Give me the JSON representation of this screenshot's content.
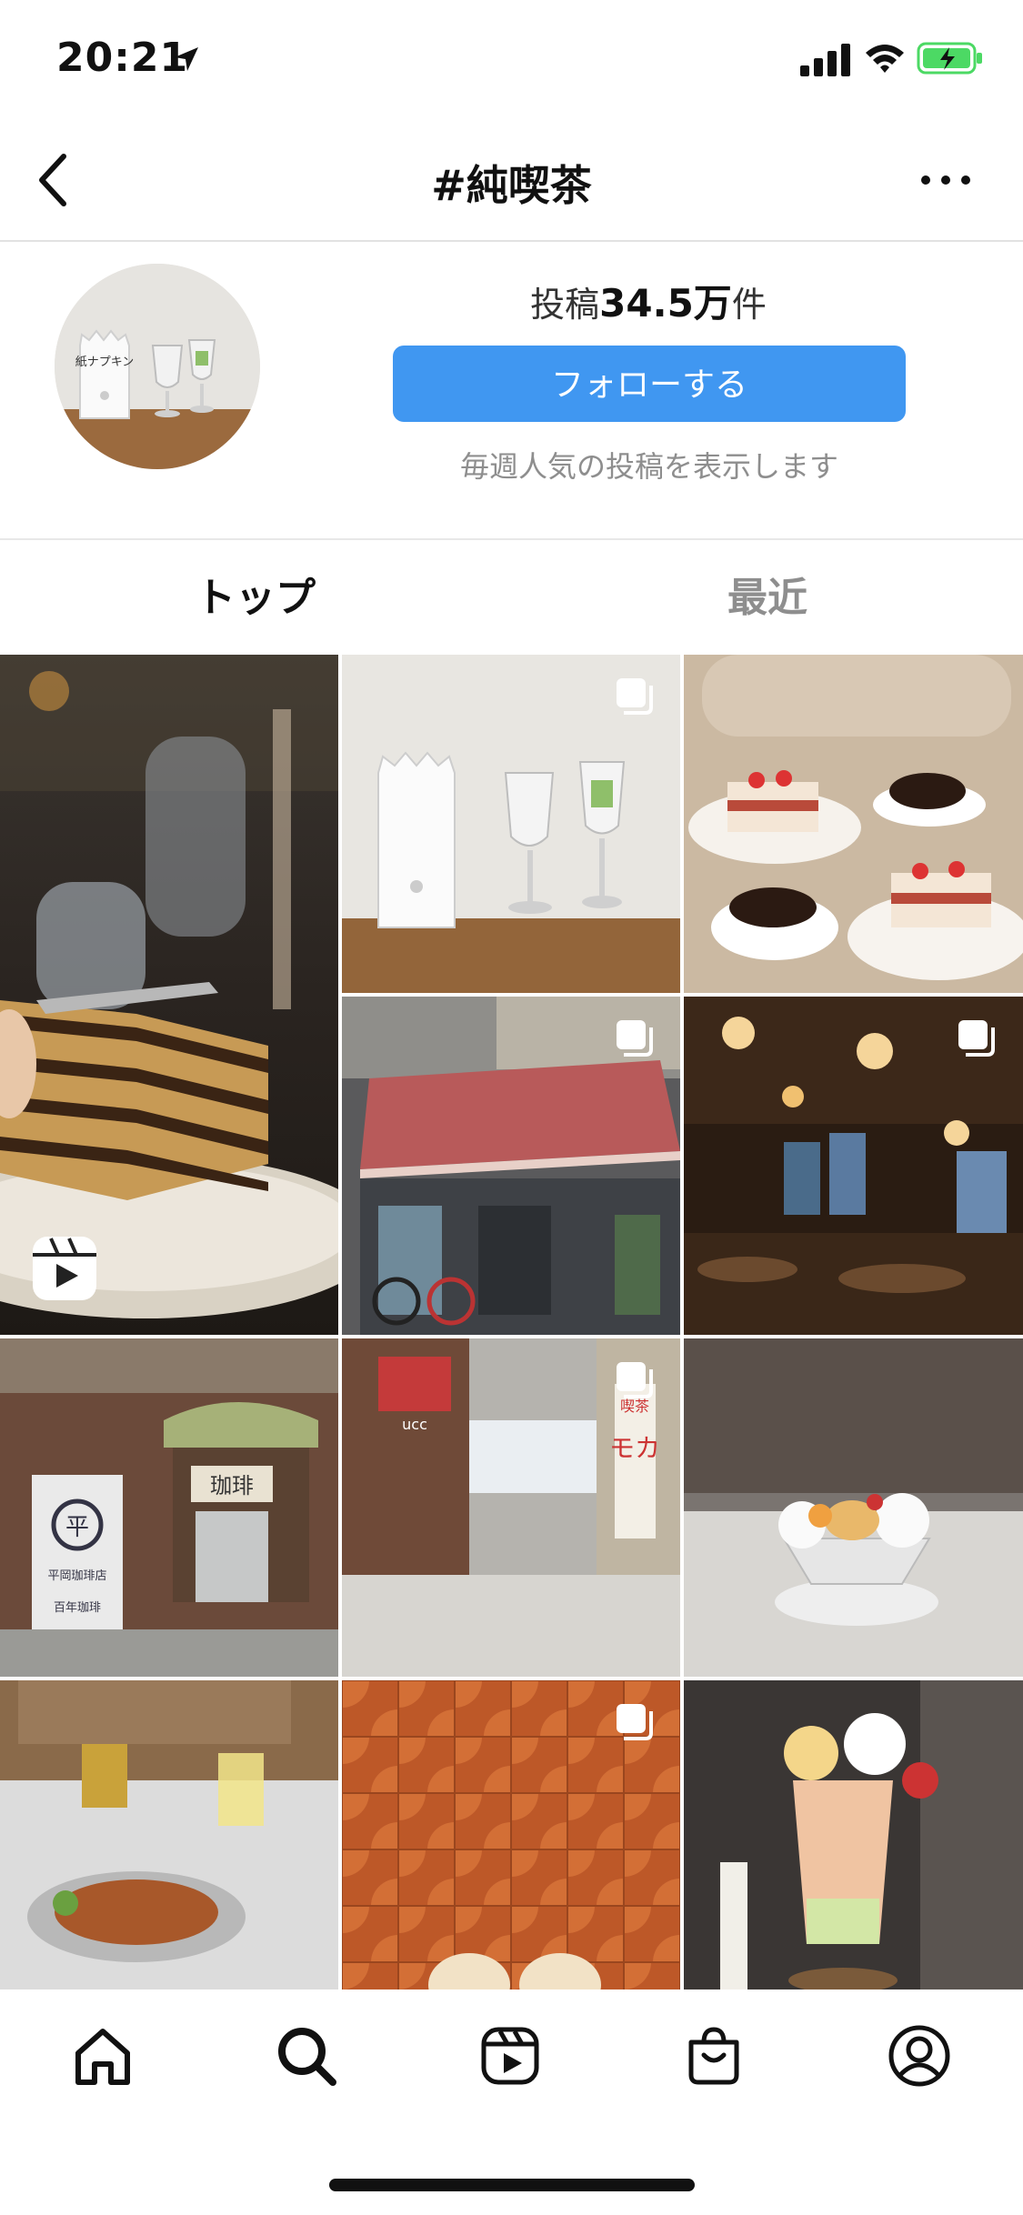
{
  "status_bar": {
    "time": "20:21"
  },
  "header": {
    "title": "#純喫茶",
    "back_icon": "chevron-left-icon",
    "more_icon": "ellipsis-icon"
  },
  "profile": {
    "posts_label": "投稿",
    "posts_count": "34.5万",
    "posts_unit": "件",
    "follow_label": "フォローする",
    "hint": "毎週人気の投稿を表示します",
    "avatar_caption": "紙ナプキン"
  },
  "tabs": [
    {
      "label": "トップ",
      "active": true
    },
    {
      "label": "最近",
      "active": false
    }
  ],
  "grid": [
    {
      "desc": "layered chocolate cake",
      "badge": "reels-icon"
    },
    {
      "desc": "napkin holder and glasses",
      "badge": "multi-photo-icon"
    },
    {
      "desc": "strawberry cakes and coffee",
      "badge": ""
    },
    {
      "desc": "cafe storefront with awning",
      "badge": "multi-photo-icon"
    },
    {
      "desc": "dark cafe interior",
      "badge": "multi-photo-icon"
    },
    {
      "desc": "old coffee shop facade",
      "badge": ""
    },
    {
      "desc": "moka cafe sign on street",
      "badge": "multi-photo-icon"
    },
    {
      "desc": "pudding parfait",
      "badge": ""
    },
    {
      "desc": "spaghetti and lemon soda",
      "badge": ""
    },
    {
      "desc": "orange tiled floor",
      "badge": "multi-photo-icon"
    },
    {
      "desc": "fruit parfait in glass",
      "badge": ""
    }
  ],
  "signs": {
    "sign1": "珈琲",
    "sign2": "喫茶",
    "sign3": "モカ",
    "sign4": "ucc",
    "sign5": "平",
    "sign6": "平岡珈琲店",
    "sign7": "百年珈琲"
  },
  "tabbar": [
    "home-icon",
    "search-icon",
    "reels-icon",
    "shop-icon",
    "profile-icon"
  ],
  "colors": {
    "accent": "#4097f1",
    "muted": "#8e8e8e",
    "battery": "#4cd964"
  }
}
